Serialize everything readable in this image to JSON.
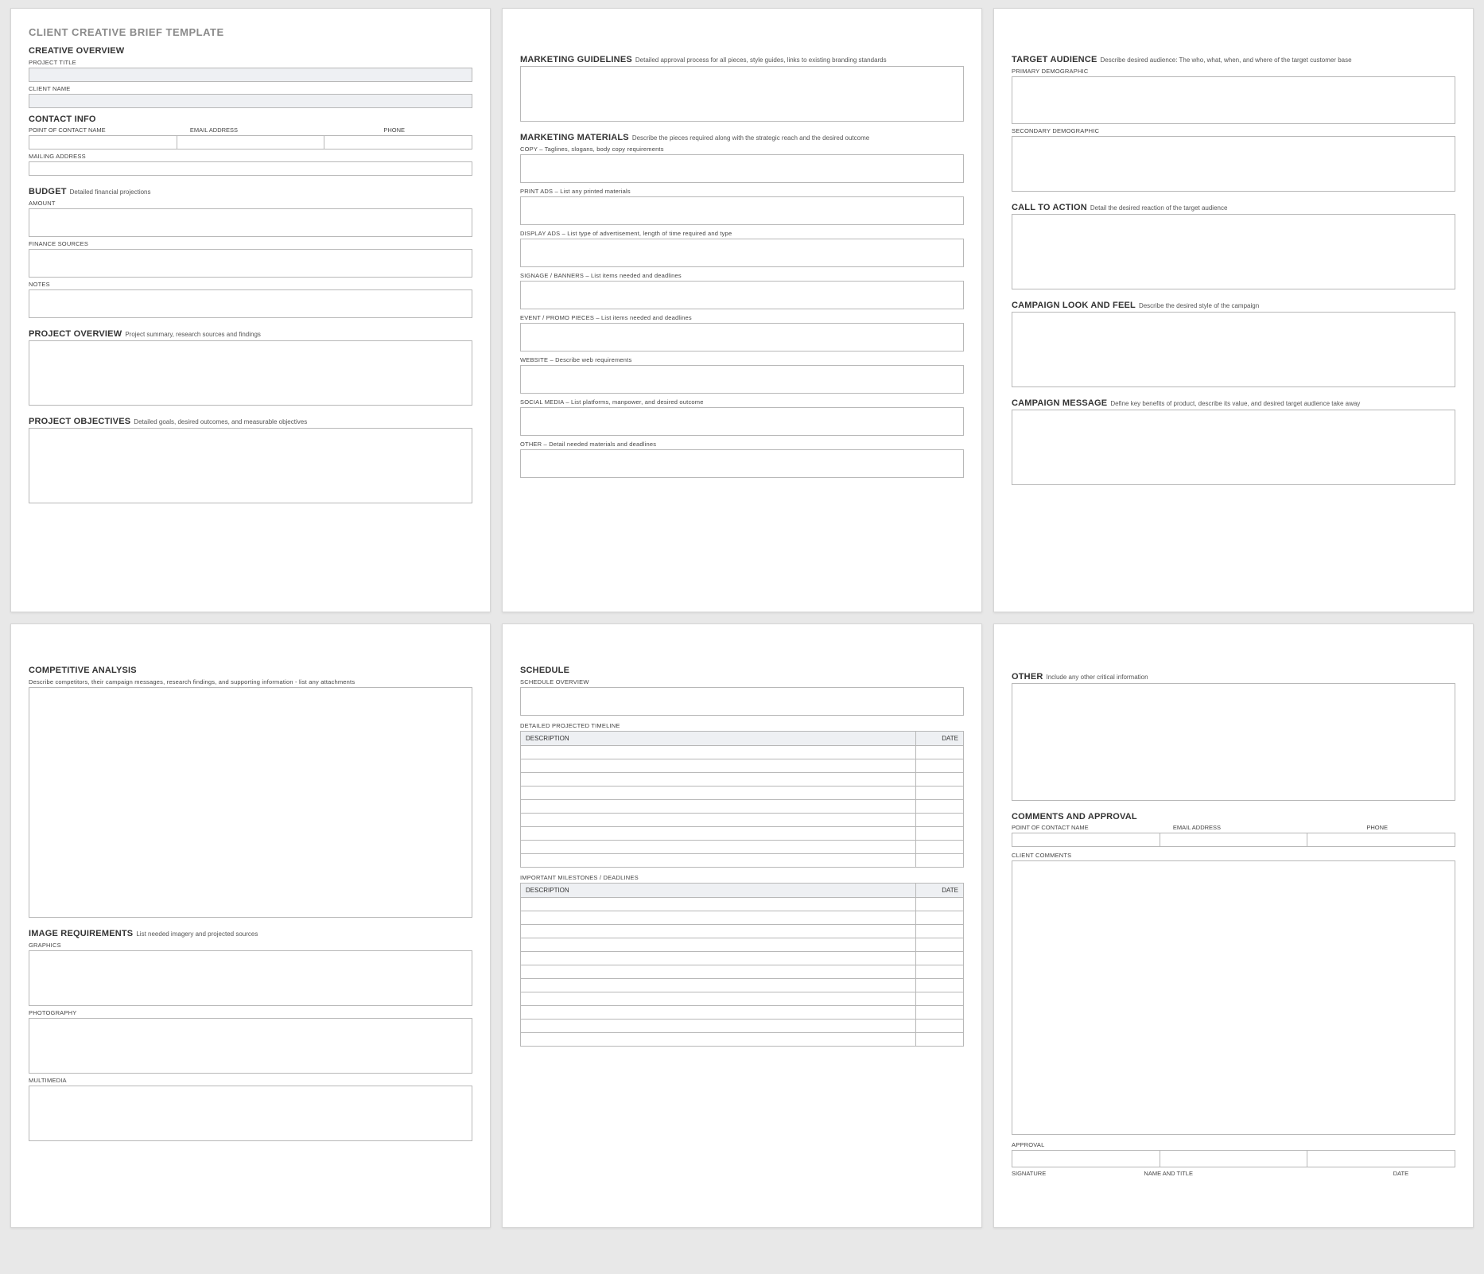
{
  "docTitle": "CLIENT CREATIVE BRIEF TEMPLATE",
  "page1": {
    "creativeOverview": "CREATIVE OVERVIEW",
    "projectTitle": "PROJECT TITLE",
    "clientName": "CLIENT NAME",
    "contactInfo": "CONTACT INFO",
    "pocName": "POINT OF CONTACT NAME",
    "email": "EMAIL ADDRESS",
    "phone": "PHONE",
    "mailing": "MAILING ADDRESS",
    "budget": "BUDGET",
    "budgetSub": "Detailed financial projections",
    "amount": "AMOUNT",
    "finance": "FINANCE SOURCES",
    "notes": "NOTES",
    "projectOverview": "PROJECT OVERVIEW",
    "projectOverviewSub": "Project summary, research sources and findings",
    "projectObjectives": "PROJECT OBJECTIVES",
    "projectObjectivesSub": "Detailed goals, desired outcomes, and measurable objectives"
  },
  "page2": {
    "marketingGuidelines": "MARKETING GUIDELINES",
    "marketingGuidelinesSub": "Detailed approval process for all pieces, style guides, links to existing branding standards",
    "marketingMaterials": "MARKETING MATERIALS",
    "marketingMaterialsSub": "Describe the pieces required along with the strategic reach and the desired outcome",
    "copy": "COPY – Taglines, slogans, body copy requirements",
    "printAds": "PRINT ADS",
    "printAdsSub": "– List any printed materials",
    "displayAds": "DISPLAY ADS",
    "displayAdsSub": "– List type of advertisement, length of time required and type",
    "signage": "SIGNAGE / BANNERS",
    "signageSub": "– List items needed and deadlines",
    "promo": "EVENT / PROMO PIECES",
    "promoSub": "– List items needed and deadlines",
    "website": "WEBSITE",
    "websiteSub": "– Describe web requirements",
    "social": "SOCIAL MEDIA",
    "socialSub": "– List platforms, manpower, and desired outcome",
    "other": "OTHER",
    "otherSub": "– Detail needed materials and deadlines"
  },
  "page3": {
    "targetAudience": "TARGET AUDIENCE",
    "targetAudienceSub": "Describe desired audience: The who, what, when, and where of the target customer base",
    "primary": "PRIMARY DEMOGRAPHIC",
    "secondary": "SECONDARY DEMOGRAPHIC",
    "cta": "CALL TO ACTION",
    "ctaSub": "Detail the desired reaction of the target audience",
    "lookFeel": "CAMPAIGN LOOK AND FEEL",
    "lookFeelSub": "Describe the desired style of the campaign",
    "message": "CAMPAIGN MESSAGE",
    "messageSub": "Define key benefits of product, describe its value, and desired target audience take away"
  },
  "page4": {
    "compAnalysis": "COMPETITIVE ANALYSIS",
    "compAnalysisSub": "Describe competitors, their campaign messages, research findings, and supporting information - list any attachments",
    "imageReq": "IMAGE REQUIREMENTS",
    "imageReqSub": "List needed imagery and projected sources",
    "graphics": "GRAPHICS",
    "photography": "PHOTOGRAPHY",
    "multimedia": "MULTIMEDIA"
  },
  "page5": {
    "schedule": "SCHEDULE",
    "scheduleOverview": "SCHEDULE OVERVIEW",
    "detailedTimeline": "DETAILED PROJECTED TIMELINE",
    "milestones": "IMPORTANT MILESTONES / DEADLINES",
    "descCol": "DESCRIPTION",
    "dateCol": "DATE"
  },
  "page6": {
    "other": "OTHER",
    "otherSub": "Include any other critical information",
    "comments": "COMMENTS AND APPROVAL",
    "pocName": "POINT OF CONTACT NAME",
    "email": "EMAIL ADDRESS",
    "phone": "PHONE",
    "clientComments": "CLIENT COMMENTS",
    "approval": "APPROVAL",
    "signature": "SIGNATURE",
    "nameTitle": "NAME AND TITLE",
    "date": "DATE"
  }
}
